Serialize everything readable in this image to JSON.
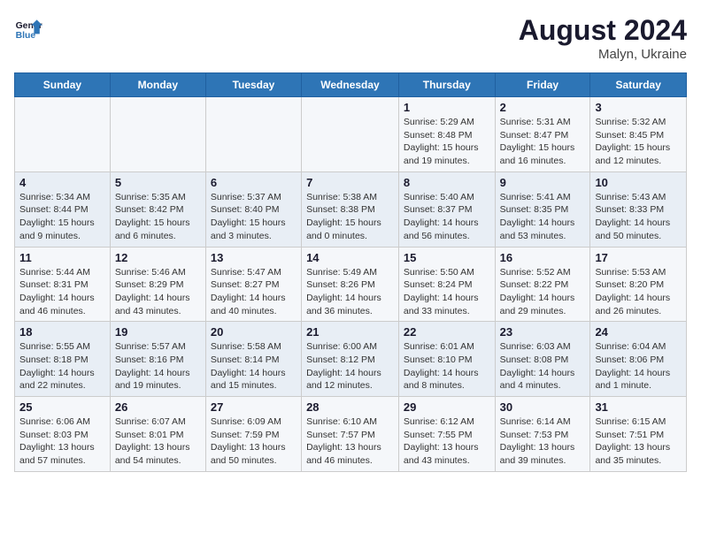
{
  "header": {
    "logo_line1": "General",
    "logo_line2": "Blue",
    "month_year": "August 2024",
    "location": "Malyn, Ukraine"
  },
  "weekdays": [
    "Sunday",
    "Monday",
    "Tuesday",
    "Wednesday",
    "Thursday",
    "Friday",
    "Saturday"
  ],
  "weeks": [
    [
      {
        "day": "",
        "info": ""
      },
      {
        "day": "",
        "info": ""
      },
      {
        "day": "",
        "info": ""
      },
      {
        "day": "",
        "info": ""
      },
      {
        "day": "1",
        "info": "Sunrise: 5:29 AM\nSunset: 8:48 PM\nDaylight: 15 hours\nand 19 minutes."
      },
      {
        "day": "2",
        "info": "Sunrise: 5:31 AM\nSunset: 8:47 PM\nDaylight: 15 hours\nand 16 minutes."
      },
      {
        "day": "3",
        "info": "Sunrise: 5:32 AM\nSunset: 8:45 PM\nDaylight: 15 hours\nand 12 minutes."
      }
    ],
    [
      {
        "day": "4",
        "info": "Sunrise: 5:34 AM\nSunset: 8:44 PM\nDaylight: 15 hours\nand 9 minutes."
      },
      {
        "day": "5",
        "info": "Sunrise: 5:35 AM\nSunset: 8:42 PM\nDaylight: 15 hours\nand 6 minutes."
      },
      {
        "day": "6",
        "info": "Sunrise: 5:37 AM\nSunset: 8:40 PM\nDaylight: 15 hours\nand 3 minutes."
      },
      {
        "day": "7",
        "info": "Sunrise: 5:38 AM\nSunset: 8:38 PM\nDaylight: 15 hours\nand 0 minutes."
      },
      {
        "day": "8",
        "info": "Sunrise: 5:40 AM\nSunset: 8:37 PM\nDaylight: 14 hours\nand 56 minutes."
      },
      {
        "day": "9",
        "info": "Sunrise: 5:41 AM\nSunset: 8:35 PM\nDaylight: 14 hours\nand 53 minutes."
      },
      {
        "day": "10",
        "info": "Sunrise: 5:43 AM\nSunset: 8:33 PM\nDaylight: 14 hours\nand 50 minutes."
      }
    ],
    [
      {
        "day": "11",
        "info": "Sunrise: 5:44 AM\nSunset: 8:31 PM\nDaylight: 14 hours\nand 46 minutes."
      },
      {
        "day": "12",
        "info": "Sunrise: 5:46 AM\nSunset: 8:29 PM\nDaylight: 14 hours\nand 43 minutes."
      },
      {
        "day": "13",
        "info": "Sunrise: 5:47 AM\nSunset: 8:27 PM\nDaylight: 14 hours\nand 40 minutes."
      },
      {
        "day": "14",
        "info": "Sunrise: 5:49 AM\nSunset: 8:26 PM\nDaylight: 14 hours\nand 36 minutes."
      },
      {
        "day": "15",
        "info": "Sunrise: 5:50 AM\nSunset: 8:24 PM\nDaylight: 14 hours\nand 33 minutes."
      },
      {
        "day": "16",
        "info": "Sunrise: 5:52 AM\nSunset: 8:22 PM\nDaylight: 14 hours\nand 29 minutes."
      },
      {
        "day": "17",
        "info": "Sunrise: 5:53 AM\nSunset: 8:20 PM\nDaylight: 14 hours\nand 26 minutes."
      }
    ],
    [
      {
        "day": "18",
        "info": "Sunrise: 5:55 AM\nSunset: 8:18 PM\nDaylight: 14 hours\nand 22 minutes."
      },
      {
        "day": "19",
        "info": "Sunrise: 5:57 AM\nSunset: 8:16 PM\nDaylight: 14 hours\nand 19 minutes."
      },
      {
        "day": "20",
        "info": "Sunrise: 5:58 AM\nSunset: 8:14 PM\nDaylight: 14 hours\nand 15 minutes."
      },
      {
        "day": "21",
        "info": "Sunrise: 6:00 AM\nSunset: 8:12 PM\nDaylight: 14 hours\nand 12 minutes."
      },
      {
        "day": "22",
        "info": "Sunrise: 6:01 AM\nSunset: 8:10 PM\nDaylight: 14 hours\nand 8 minutes."
      },
      {
        "day": "23",
        "info": "Sunrise: 6:03 AM\nSunset: 8:08 PM\nDaylight: 14 hours\nand 4 minutes."
      },
      {
        "day": "24",
        "info": "Sunrise: 6:04 AM\nSunset: 8:06 PM\nDaylight: 14 hours\nand 1 minute."
      }
    ],
    [
      {
        "day": "25",
        "info": "Sunrise: 6:06 AM\nSunset: 8:03 PM\nDaylight: 13 hours\nand 57 minutes."
      },
      {
        "day": "26",
        "info": "Sunrise: 6:07 AM\nSunset: 8:01 PM\nDaylight: 13 hours\nand 54 minutes."
      },
      {
        "day": "27",
        "info": "Sunrise: 6:09 AM\nSunset: 7:59 PM\nDaylight: 13 hours\nand 50 minutes."
      },
      {
        "day": "28",
        "info": "Sunrise: 6:10 AM\nSunset: 7:57 PM\nDaylight: 13 hours\nand 46 minutes."
      },
      {
        "day": "29",
        "info": "Sunrise: 6:12 AM\nSunset: 7:55 PM\nDaylight: 13 hours\nand 43 minutes."
      },
      {
        "day": "30",
        "info": "Sunrise: 6:14 AM\nSunset: 7:53 PM\nDaylight: 13 hours\nand 39 minutes."
      },
      {
        "day": "31",
        "info": "Sunrise: 6:15 AM\nSunset: 7:51 PM\nDaylight: 13 hours\nand 35 minutes."
      }
    ]
  ]
}
